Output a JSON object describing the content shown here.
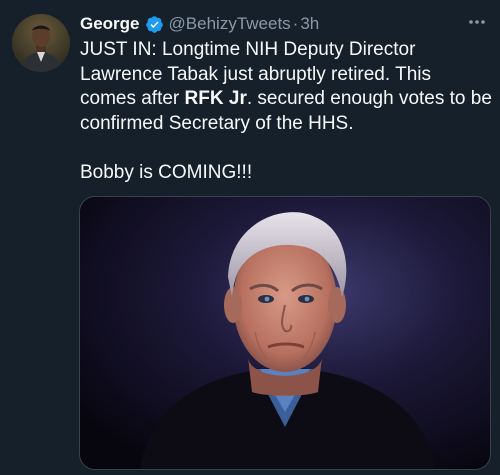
{
  "author": {
    "name": "George",
    "handle": "@BehizyTweets",
    "separator": "·",
    "time": "3h",
    "verified_color": "#1d9bf0"
  },
  "tweet": {
    "line1_before": "JUST IN: Longtime NIH Deputy Director Lawrence Tabak just abruptly retired. This comes after ",
    "mention": "RFK Jr",
    "line1_after": ". secured enough votes to be confirmed Secretary of the HHS.",
    "line2": "Bobby is COMING!!!"
  },
  "icons": {
    "verified": "verified-badge-icon",
    "more": "more-options-icon"
  },
  "colors": {
    "background": "#15202b",
    "text": "#f7f9f9",
    "muted": "#8b98a5",
    "accent": "#1d9bf0"
  }
}
